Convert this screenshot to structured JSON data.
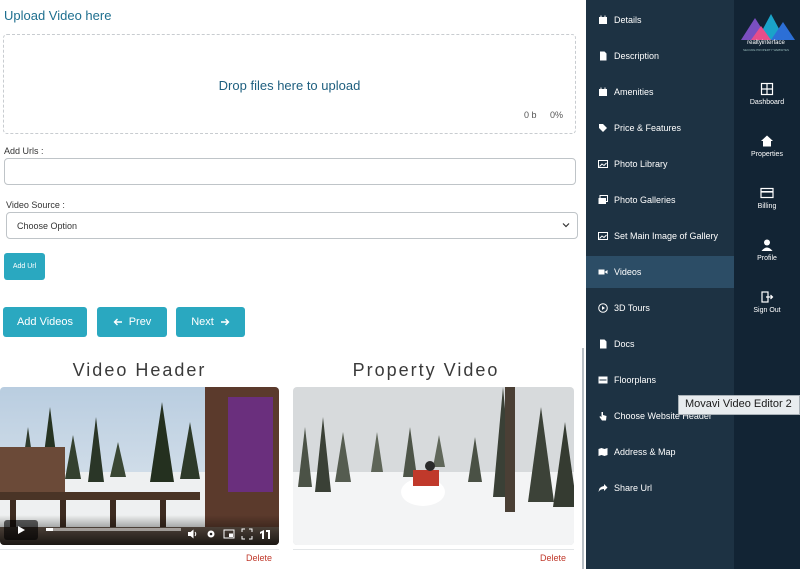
{
  "upload": {
    "title": "Upload Video here",
    "drop_text": "Drop files here to upload",
    "size": "0 b",
    "percent": "0%"
  },
  "form": {
    "urls_label": "Add Urls :",
    "urls_value": "",
    "source_label": "Video Source :",
    "source_selected": "Choose Option",
    "add_url_label": "Add Url"
  },
  "actions": {
    "add_videos": "Add Videos",
    "prev": "Prev",
    "next": "Next"
  },
  "videos": {
    "header_title": "Video Header",
    "property_title": "Property Video",
    "header_delete": "Delete",
    "property_delete": "Delete",
    "header_progress": 0.05
  },
  "nav": {
    "items": [
      {
        "label": "Details",
        "icon": "calendar-icon"
      },
      {
        "label": "Description",
        "icon": "file-icon"
      },
      {
        "label": "Amenities",
        "icon": "calendar-icon"
      },
      {
        "label": "Price & Features",
        "icon": "tag-icon"
      },
      {
        "label": "Photo Library",
        "icon": "image-icon"
      },
      {
        "label": "Photo Galleries",
        "icon": "images-icon"
      },
      {
        "label": "Set Main Image of Gallery",
        "icon": "image-icon"
      },
      {
        "label": "Videos",
        "icon": "video-icon"
      },
      {
        "label": "3D Tours",
        "icon": "play-circle-icon"
      },
      {
        "label": "Docs",
        "icon": "file-icon"
      },
      {
        "label": "Floorplans",
        "icon": "layout-icon"
      },
      {
        "label": "Choose Website Header",
        "icon": "hand-pointer-icon"
      },
      {
        "label": "Address & Map",
        "icon": "map-icon"
      },
      {
        "label": "Share Url",
        "icon": "share-icon"
      }
    ],
    "active": "Videos"
  },
  "brand": {
    "name": "realtyinterface",
    "tagline": "SECURE PROPERTY WEBSITES"
  },
  "side": {
    "dashboard": "Dashboard",
    "properties": "Properties",
    "billing": "Billing",
    "profile": "Profile",
    "signout": "Sign Out"
  },
  "tooltip": {
    "text": "Movavi Video Editor 2"
  },
  "colors": {
    "accent": "#2aa8c0",
    "panel": "#1d3243",
    "panel_dark": "#122434",
    "active": "#2c4d66",
    "delete": "#c0392b"
  }
}
